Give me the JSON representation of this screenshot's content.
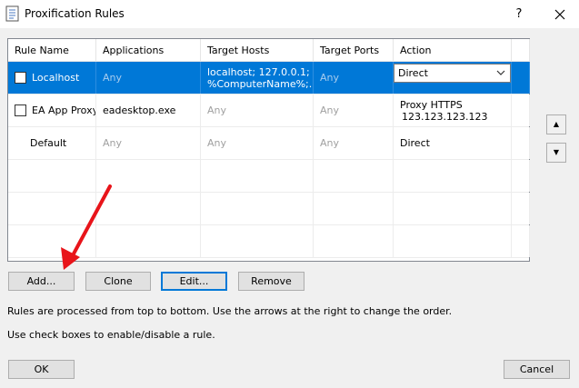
{
  "window": {
    "title": "Proxification Rules",
    "help_label": "?"
  },
  "table": {
    "columns": [
      "Rule Name",
      "Applications",
      "Target Hosts",
      "Target Ports",
      "Action"
    ],
    "rows": [
      {
        "name": "Localhost",
        "checked": false,
        "applications": "Any",
        "hosts_line1": "localhost; 127.0.0.1;",
        "hosts_line2": "%ComputerName%;...",
        "ports": "Any",
        "action": "Direct",
        "selected": true
      },
      {
        "name": "EA App Proxy",
        "checked": false,
        "applications": "eadesktop.exe",
        "hosts": "Any",
        "ports": "Any",
        "action_line1": "Proxy HTTPS",
        "action_line2": "123.123.123.123",
        "selected": false
      },
      {
        "name": "Default",
        "applications": "Any",
        "hosts": "Any",
        "ports": "Any",
        "action": "Direct",
        "selected": false
      }
    ]
  },
  "side_buttons": {
    "up": "▲",
    "down": "▼"
  },
  "buttons": {
    "add": "Add...",
    "clone": "Clone",
    "edit": "Edit...",
    "remove": "Remove",
    "ok": "OK",
    "cancel": "Cancel"
  },
  "info": {
    "line1": "Rules are processed from top to bottom. Use the arrows at the right to change the order.",
    "line2": "Use check boxes to enable/disable a rule."
  },
  "colors": {
    "selection": "#0078d7",
    "annotation_arrow": "#e8141a"
  }
}
